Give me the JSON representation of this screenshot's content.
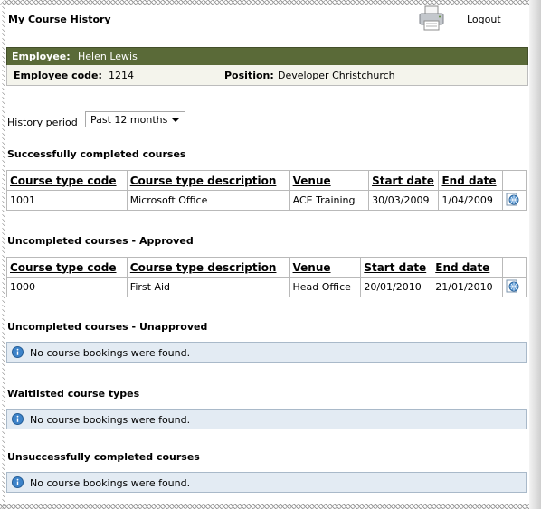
{
  "header": {
    "title": "My Course History",
    "logout_label": "Logout"
  },
  "employee": {
    "name_label": "Employee:",
    "name": "Helen Lewis",
    "code_label": "Employee code:",
    "code": "1214",
    "position_label": "Position:",
    "position": "Developer Christchurch"
  },
  "history": {
    "label": "History period",
    "selected": "Past 12 months"
  },
  "sections": {
    "completed": {
      "title": "Successfully completed courses",
      "columns": [
        "Course type code",
        "Course type description",
        "Venue",
        "Start date",
        "End date"
      ],
      "rows": [
        {
          "code": "1001",
          "description": "Microsoft Office",
          "venue": "ACE Training",
          "start": "30/03/2009",
          "end": "1/04/2009"
        }
      ]
    },
    "approved": {
      "title": "Uncompleted courses - Approved",
      "columns": [
        "Course type code",
        "Course type description",
        "Venue",
        "Start date",
        "End date"
      ],
      "rows": [
        {
          "code": "1000",
          "description": "First Aid",
          "venue": "Head Office",
          "start": "20/01/2010",
          "end": "21/01/2010"
        }
      ]
    },
    "unapproved": {
      "title": "Uncompleted courses - Unapproved",
      "message": "No course bookings were found."
    },
    "waitlisted": {
      "title": "Waitlisted course types",
      "message": "No course bookings were found."
    },
    "unsuccessful": {
      "title": "Unsuccessfully completed courses",
      "message": "No course bookings were found."
    }
  },
  "icons": {
    "printer": "printer-icon",
    "info": "info-icon",
    "details": "globe-details-icon"
  },
  "colors": {
    "employee_bar": "#5a6a38",
    "message_bg": "#e3ebf3",
    "detail_bg": "#f4f4ec"
  }
}
